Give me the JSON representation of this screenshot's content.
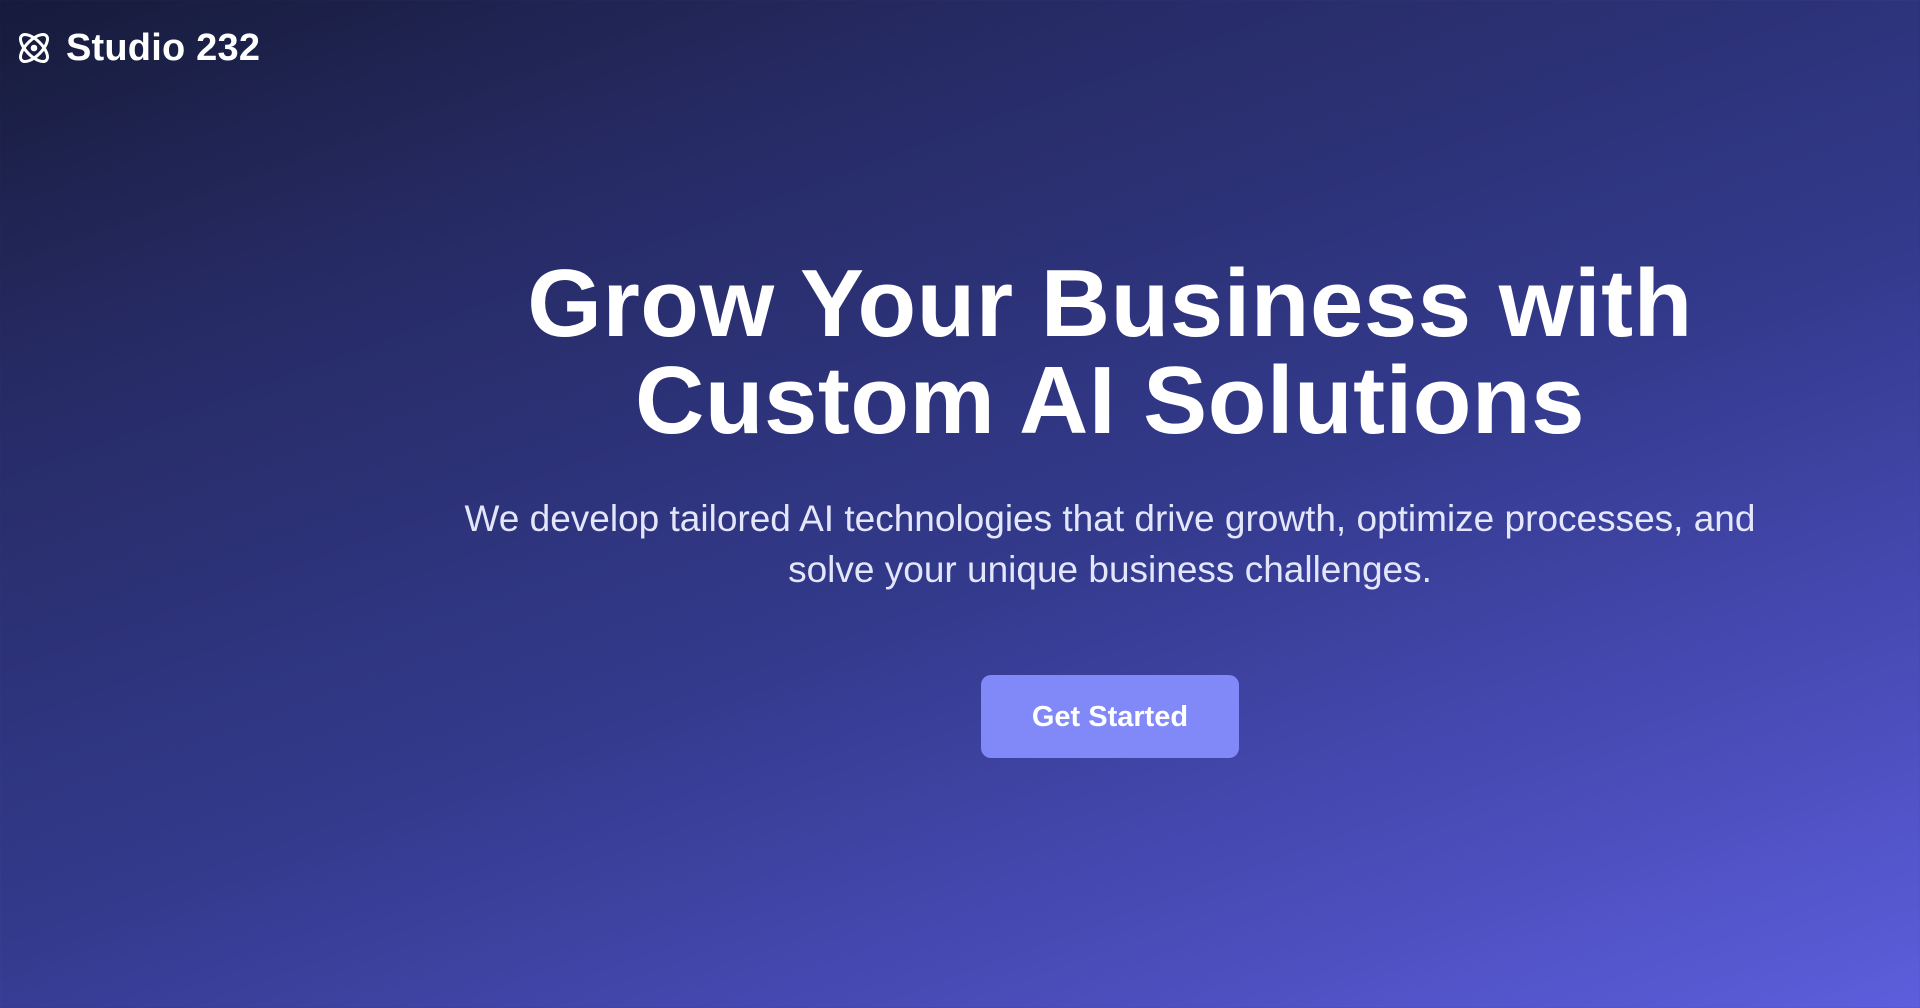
{
  "brand": {
    "name": "Studio 232",
    "icon": "atom-icon"
  },
  "hero": {
    "title": "Grow Your Business with Custom AI Solutions",
    "subtitle": "We develop tailored AI technologies that drive growth, optimize processes, and solve your unique business challenges.",
    "cta_label": "Get Started"
  },
  "colors": {
    "background_start": "#161b3a",
    "background_end": "#5c5edc",
    "cta_background": "#8188f8",
    "text": "#ffffff",
    "subtitle_text": "#e4e6fb"
  }
}
